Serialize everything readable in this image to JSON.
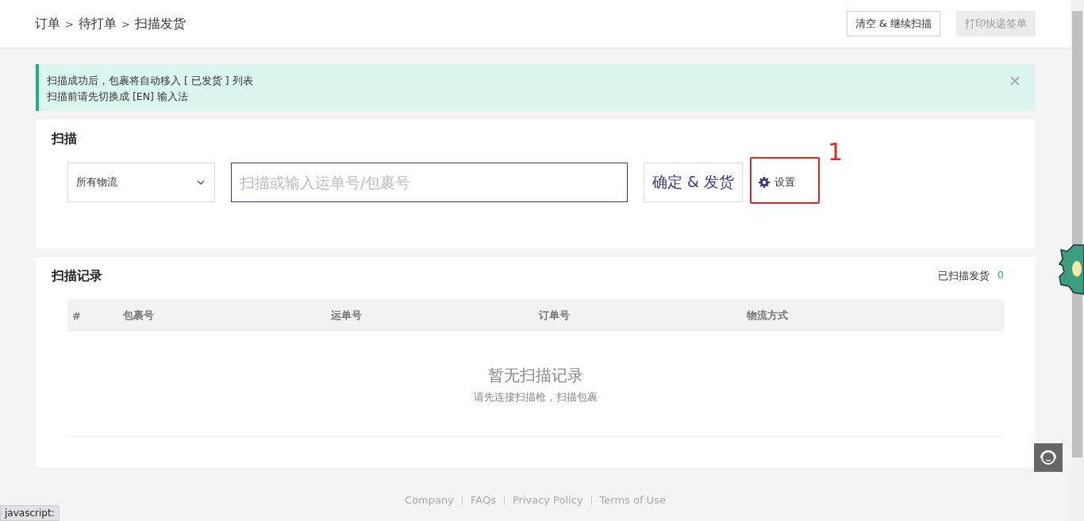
{
  "breadcrumb": [
    "订单",
    "待打单",
    "扫描发货"
  ],
  "breadcrumb_separators": [
    ">",
    ">"
  ],
  "header_buttons": [
    {
      "label": "清空 & 继续扫描",
      "disabled": false
    },
    {
      "label": "打印快递签单",
      "disabled": true
    }
  ],
  "alert": {
    "lines": [
      "扫描成功后，包裹将自动移入 [ 已发货 ] 列表",
      "扫描前请先切换成 [EN] 输入法"
    ]
  },
  "scan": {
    "title": "扫描",
    "carrier_select": {
      "value": "所有物流"
    },
    "input": {
      "placeholder": "扫描或输入运单号/包裹号"
    },
    "confirm_button": "确定 & 发货",
    "settings_button": "设置",
    "annotation": {
      "label": "1"
    }
  },
  "records": {
    "title": "扫描记录",
    "counter_label": "已扫描发货",
    "counter_value": "0",
    "table": {
      "columns": [
        "#",
        "包裹号",
        "运单号",
        "订单号",
        "物流方式"
      ]
    },
    "empty_title": "暂无扫描记录",
    "empty_hint": "请先连接扫描枪，扫描包裹"
  },
  "footer_links": [
    "Company",
    "FAQs",
    "Privacy Policy",
    "Terms of Use"
  ],
  "status_bar": "javascript:"
}
